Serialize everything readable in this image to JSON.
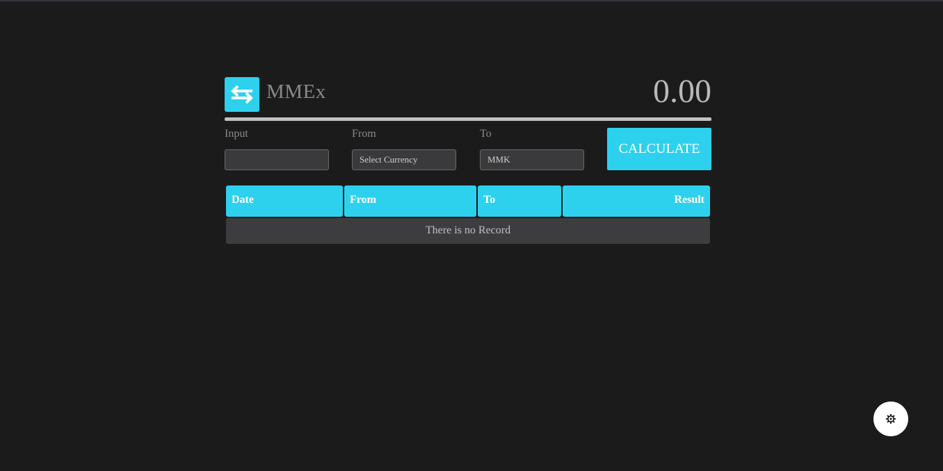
{
  "app": {
    "name": "MMEx",
    "logo_icon": "swap-arrows-icon",
    "brand_color": "#2dd1ee"
  },
  "result": {
    "value": "0.00"
  },
  "form": {
    "input_label": "Input",
    "input_value": "",
    "from_label": "From",
    "from_selected": "Select Currency",
    "to_label": "To",
    "to_selected": "MMK",
    "calculate_label": "CALCULATE"
  },
  "history_table": {
    "columns": [
      "Date",
      "From",
      "To",
      "Result"
    ],
    "empty_message": "There is no Record"
  },
  "settings": {
    "icon": "gear-icon"
  }
}
